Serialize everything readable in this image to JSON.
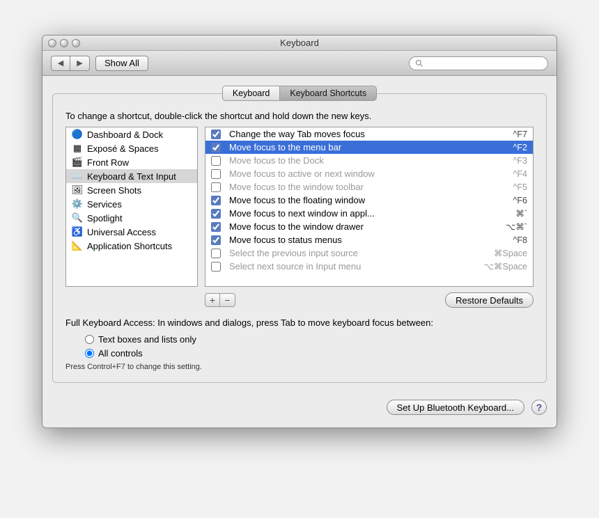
{
  "window": {
    "title": "Keyboard"
  },
  "toolbar": {
    "back_icon": "◀",
    "fwd_icon": "▶",
    "show_all": "Show All",
    "search_placeholder": ""
  },
  "tabs": [
    {
      "label": "Keyboard",
      "active": false
    },
    {
      "label": "Keyboard Shortcuts",
      "active": true
    }
  ],
  "instruction": "To change a shortcut, double-click the shortcut and hold down the new keys.",
  "categories": [
    {
      "label": "Dashboard & Dock",
      "icon": "🔵",
      "selected": false
    },
    {
      "label": "Exposé & Spaces",
      "icon": "▦",
      "selected": false
    },
    {
      "label": "Front Row",
      "icon": "🎬",
      "selected": false
    },
    {
      "label": "Keyboard & Text Input",
      "icon": "⌨️",
      "selected": true
    },
    {
      "label": "Screen Shots",
      "icon": "🖼",
      "selected": false
    },
    {
      "label": "Services",
      "icon": "⚙️",
      "selected": false
    },
    {
      "label": "Spotlight",
      "icon": "🔍",
      "selected": false
    },
    {
      "label": "Universal Access",
      "icon": "♿",
      "selected": false
    },
    {
      "label": "Application Shortcuts",
      "icon": "📐",
      "selected": false
    }
  ],
  "shortcuts": [
    {
      "checked": true,
      "label": "Change the way Tab moves focus",
      "key": "^F7",
      "selected": false,
      "dim": false
    },
    {
      "checked": true,
      "label": "Move focus to the menu bar",
      "key": "^F2",
      "selected": true,
      "dim": false
    },
    {
      "checked": false,
      "label": "Move focus to the Dock",
      "key": "^F3",
      "selected": false,
      "dim": true
    },
    {
      "checked": false,
      "label": "Move focus to active or next window",
      "key": "^F4",
      "selected": false,
      "dim": true
    },
    {
      "checked": false,
      "label": "Move focus to the window toolbar",
      "key": "^F5",
      "selected": false,
      "dim": true
    },
    {
      "checked": true,
      "label": "Move focus to the floating window",
      "key": "^F6",
      "selected": false,
      "dim": false
    },
    {
      "checked": true,
      "label": "Move focus to next window in appl...",
      "key": "⌘`",
      "selected": false,
      "dim": false
    },
    {
      "checked": true,
      "label": "Move focus to the window drawer",
      "key": "⌥⌘`",
      "selected": false,
      "dim": false
    },
    {
      "checked": true,
      "label": "Move focus to status menus",
      "key": "^F8",
      "selected": false,
      "dim": false
    },
    {
      "checked": false,
      "label": "Select the previous input source",
      "key": "⌘Space",
      "selected": false,
      "dim": true
    },
    {
      "checked": false,
      "label": "Select next source in Input menu",
      "key": "⌥⌘Space",
      "selected": false,
      "dim": true
    }
  ],
  "buttons": {
    "plus": "+",
    "minus": "−",
    "restore": "Restore Defaults",
    "bluetooth": "Set Up Bluetooth Keyboard...",
    "help": "?"
  },
  "fka": {
    "heading": "Full Keyboard Access: In windows and dialogs, press Tab to move keyboard focus between:",
    "opt1": "Text boxes and lists only",
    "opt2": "All controls",
    "selected": "opt2",
    "note": "Press Control+F7 to change this setting."
  }
}
